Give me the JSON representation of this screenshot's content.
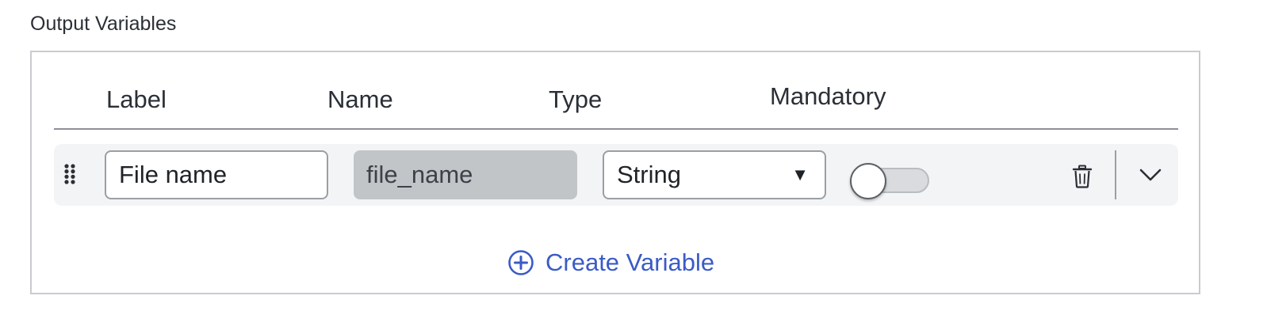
{
  "section": {
    "title": "Output Variables"
  },
  "columns": {
    "label": "Label",
    "name": "Name",
    "type": "Type",
    "mandatory": "Mandatory"
  },
  "rows": [
    {
      "label_value": "File name",
      "name_value": "file_name",
      "type_value": "String",
      "mandatory": false
    }
  ],
  "icons": {
    "drag": "drag-handle-icon",
    "select_caret": "▼",
    "delete": "trash-icon",
    "expand": "chevron-down-icon",
    "create": "plus-circle-icon"
  },
  "actions": {
    "create_variable": "Create Variable"
  },
  "colors": {
    "accent": "#3a5bc7",
    "row_background": "#f3f4f5",
    "name_field_background": "#c2c5c8"
  }
}
